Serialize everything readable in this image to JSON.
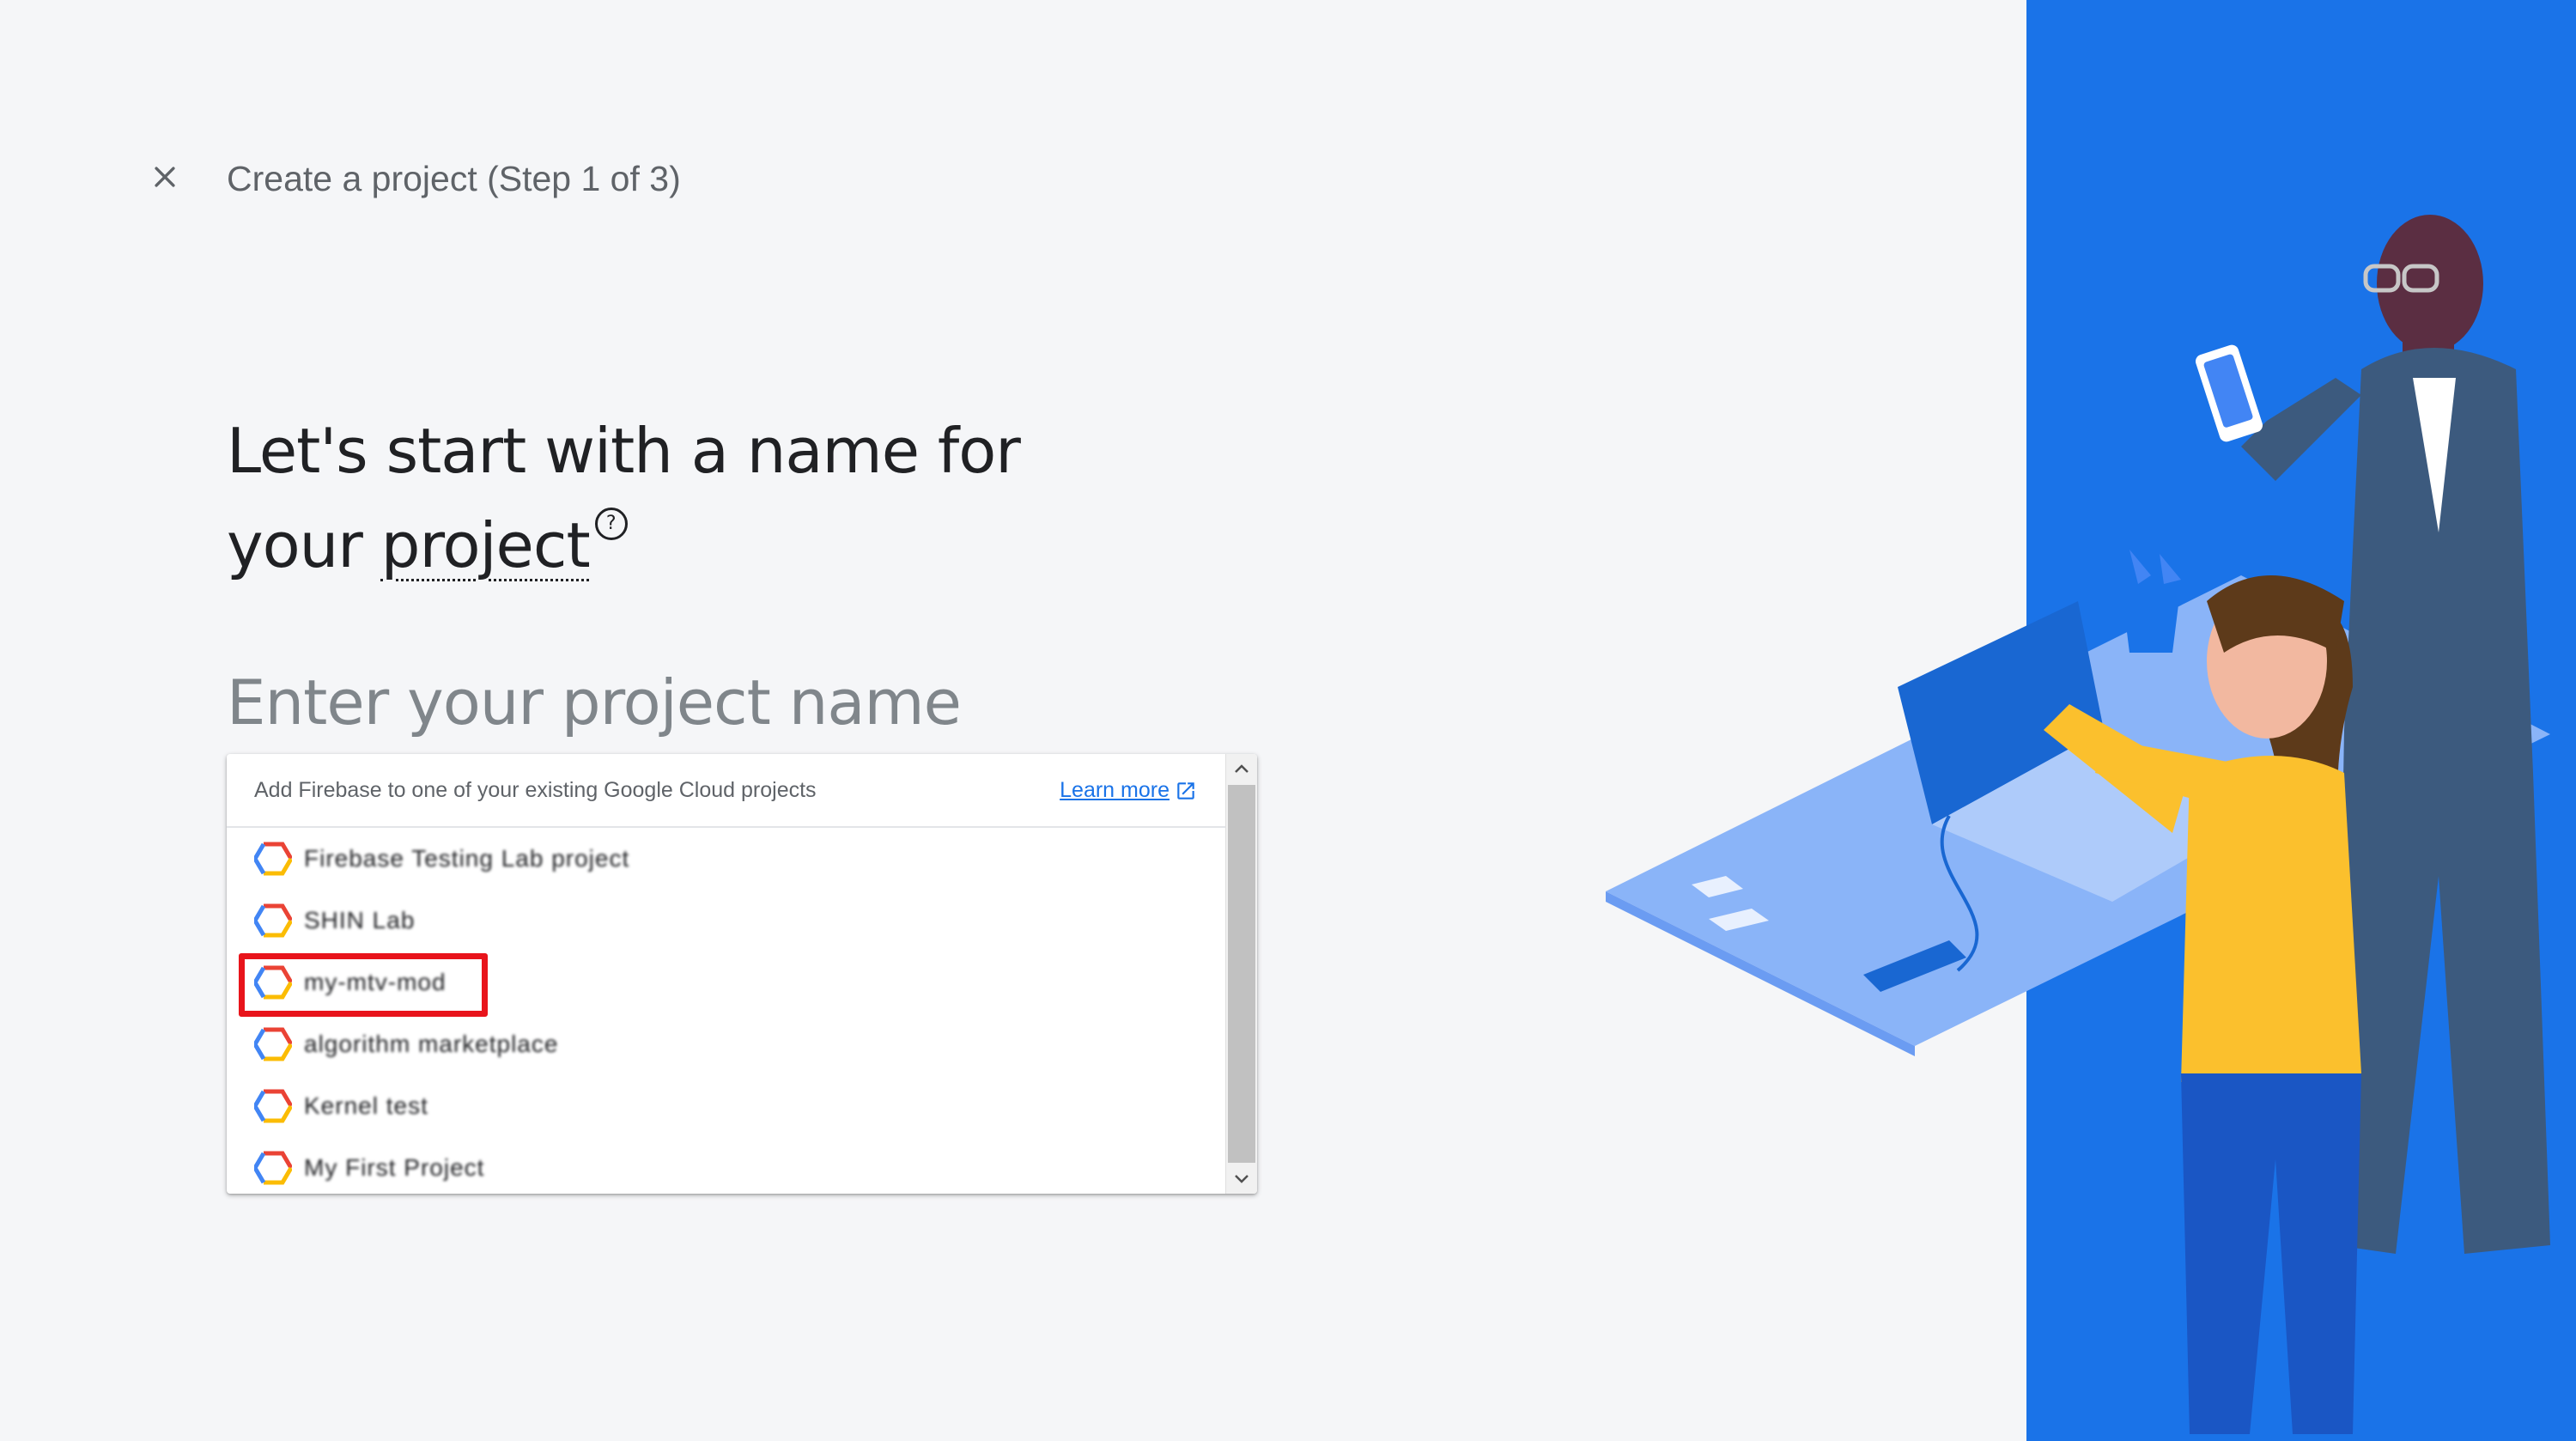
{
  "header": {
    "close_icon": "close-icon",
    "step_title": "Create a project (Step 1 of 3)"
  },
  "heading": {
    "line1": "Let's start with a name for",
    "line2_prefix": "your ",
    "project_link": "project",
    "help_glyph": "?"
  },
  "name_input": {
    "placeholder": "Enter your project name",
    "value": ""
  },
  "dropdown": {
    "hint": "Add Firebase to one of your existing Google Cloud projects",
    "learn_more": "Learn more",
    "learn_more_icon": "open-in-new-icon",
    "item_icon": "google-cloud-hexagon-icon",
    "items": [
      {
        "label": "Firebase Testing Lab project"
      },
      {
        "label": "SHIN Lab"
      },
      {
        "label": "my-mtv-mod"
      },
      {
        "label": "algorithm marketplace"
      },
      {
        "label": "Kernel test"
      },
      {
        "label": "My First Project"
      }
    ],
    "highlighted_index": 2
  },
  "colors": {
    "background": "#f5f6f8",
    "panel_blue": "#1a73e8",
    "link_blue": "#1a73e8",
    "highlight_red": "#e8141b",
    "text_primary": "#202124",
    "text_secondary": "#5f6368"
  }
}
